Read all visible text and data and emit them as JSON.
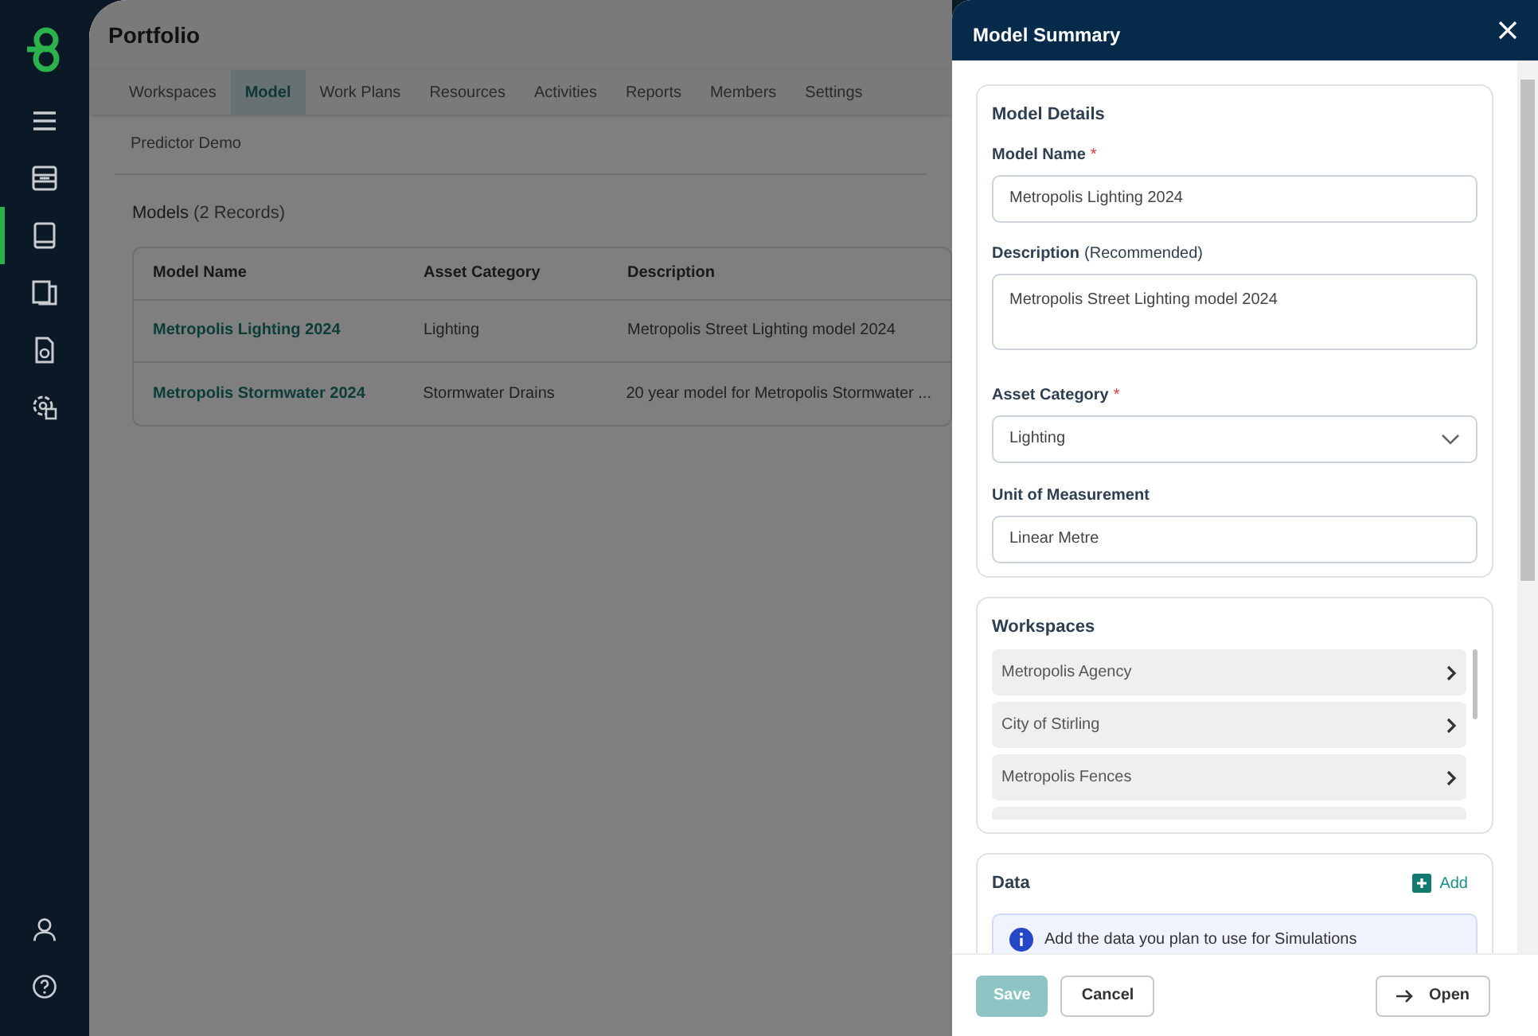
{
  "sidebar": {
    "items": [
      {
        "selected": false
      },
      {
        "selected": false
      },
      {
        "selected": true
      },
      {
        "selected": false
      },
      {
        "selected": false
      },
      {
        "selected": false
      }
    ]
  },
  "page": {
    "title": "Portfolio",
    "tabs": [
      {
        "label": "Workspaces",
        "selected": false
      },
      {
        "label": "Model",
        "selected": true
      },
      {
        "label": "Work Plans",
        "selected": false
      },
      {
        "label": "Resources",
        "selected": false
      },
      {
        "label": "Activities",
        "selected": false
      },
      {
        "label": "Reports",
        "selected": false
      },
      {
        "label": "Members",
        "selected": false
      },
      {
        "label": "Settings",
        "selected": false
      }
    ],
    "breadcrumb": "Predictor Demo",
    "section_title": "Models",
    "record_count": "(2 Records)",
    "table": {
      "columns": [
        "Model Name",
        "Asset Category",
        "Description"
      ],
      "rows": [
        [
          "Metropolis Lighting 2024",
          "Lighting",
          "Metropolis Street Lighting model 2024"
        ],
        [
          "Metropolis Stormwater 2024",
          "Stormwater Drains",
          "20 year model for Metropolis Stormwater ..."
        ]
      ]
    }
  },
  "panel": {
    "title": "Model Summary",
    "details": {
      "heading": "Model Details",
      "fields": [
        {
          "kind": "text",
          "label": "Model Name",
          "required_mark": "*",
          "value": "Metropolis Lighting 2024"
        },
        {
          "kind": "textarea",
          "label": "Description",
          "hint": "(Recommended)",
          "value": "Metropolis Street Lighting model 2024"
        },
        {
          "kind": "select",
          "label": "Asset Category",
          "required_mark": "*",
          "value": "Lighting"
        },
        {
          "kind": "text",
          "label": "Unit of Measurement",
          "value": "Linear Metre"
        }
      ]
    },
    "workspaces": {
      "heading": "Workspaces",
      "items": [
        "Metropolis Agency",
        "City of Stirling",
        "Metropolis Fences"
      ]
    },
    "data": {
      "heading": "Data",
      "add_label": "Add",
      "info": "Add the data you plan to use for Simulations"
    },
    "buttons": [
      {
        "kind": "primary",
        "label": "Save",
        "disabled": true
      },
      {
        "kind": "secondary",
        "label": "Cancel",
        "disabled": false
      },
      {
        "kind": "open",
        "label": "Open",
        "disabled": false
      }
    ]
  }
}
